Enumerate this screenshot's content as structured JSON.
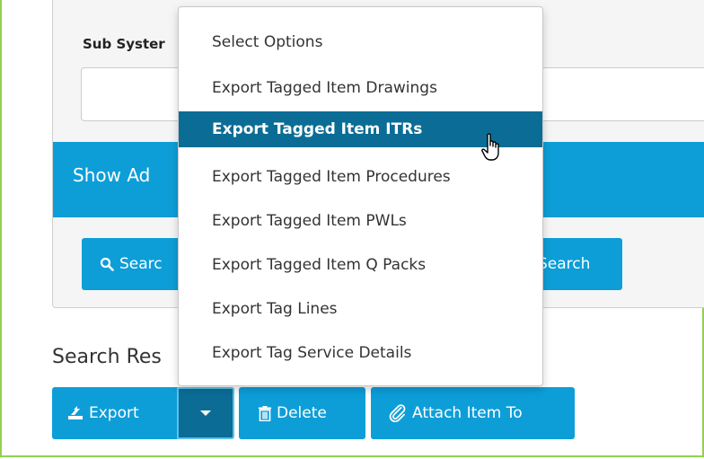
{
  "filters": {
    "sub_system_label": "Sub Syster",
    "sub_system_value": ""
  },
  "advanced": {
    "toggle_label": "Show Ad"
  },
  "actions": {
    "search_label": "Searc",
    "advanced_search_label": "Search"
  },
  "results": {
    "heading": "Search Res"
  },
  "toolbar": {
    "export_label": "Export",
    "delete_label": "Delete",
    "attach_label": "Attach Item To"
  },
  "dropdown": {
    "items": [
      {
        "label": "Select Options"
      },
      {
        "label": "Export Tagged Item Drawings"
      },
      {
        "label": "Export Tagged Item ITRs",
        "active": true
      },
      {
        "label": "Export Tagged Item Procedures"
      },
      {
        "label": "Export Tagged Item PWLs"
      },
      {
        "label": "Export Tagged Item Q Packs"
      },
      {
        "label": "Export Tag Lines"
      },
      {
        "label": "Export Tag Service Details"
      }
    ]
  },
  "icons": {
    "search": "magnifier-icon",
    "export": "export-icon",
    "delete": "trash-icon",
    "attach": "paperclip-icon",
    "caret": "caret-down-icon",
    "cursor": "hand-pointer-icon"
  },
  "colors": {
    "primary": "#0d9ed8",
    "primary_dark": "#0b6d96",
    "frame_border": "#92d050"
  }
}
